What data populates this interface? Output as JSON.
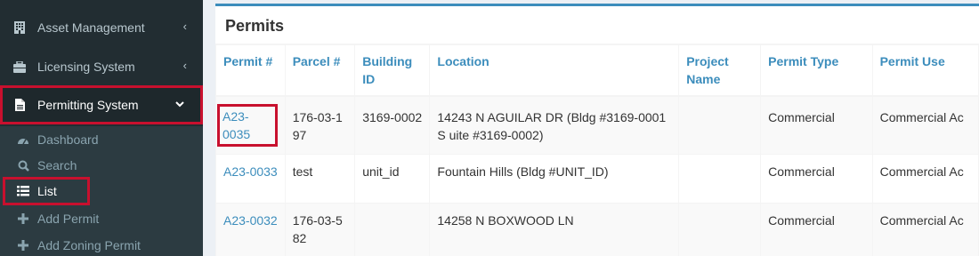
{
  "sidebar": {
    "items": [
      {
        "label": "Asset Management",
        "icon": "building-icon",
        "chevron": "‹"
      },
      {
        "label": "Licensing System",
        "icon": "briefcase-icon",
        "chevron": "‹"
      },
      {
        "label": "Permitting System",
        "icon": "file-icon",
        "chevron": "⌄"
      }
    ],
    "subitems": [
      {
        "label": "Dashboard",
        "icon": "dashboard-icon"
      },
      {
        "label": "Search",
        "icon": "search-icon"
      },
      {
        "label": "List",
        "icon": "list-icon"
      },
      {
        "label": "Add Permit",
        "icon": "plus-icon"
      },
      {
        "label": "Add Zoning Permit",
        "icon": "plus-icon"
      }
    ]
  },
  "box": {
    "title": "Permits"
  },
  "table": {
    "headers": {
      "permit": "Permit #",
      "parcel": "Parcel #",
      "building_line1": "Building",
      "building_line2": "ID",
      "location": "Location",
      "project_line1": "Project",
      "project_line2": "Name",
      "type": "Permit Type",
      "use": "Permit Use"
    },
    "rows": [
      {
        "permit": "A23-0035",
        "parcel": "176-03-1 97",
        "building": "3169-0002",
        "location": "14243 N AGUILAR DR (Bldg #3169-0001 S uite #3169-0002)",
        "project": "",
        "type": "Commercial",
        "use": "Commercial Ac"
      },
      {
        "permit": "A23-0033",
        "parcel": "test",
        "building": "unit_id",
        "location": "Fountain Hills (Bldg #UNIT_ID)",
        "project": "",
        "type": "Commercial",
        "use": "Commercial Ac"
      },
      {
        "permit": "A23-0032",
        "parcel": "176-03-5 82",
        "building": "",
        "location": "14258 N BOXWOOD LN",
        "project": "",
        "type": "Commercial",
        "use": "Commercial Ac"
      }
    ]
  },
  "colors": {
    "sidebar_bg": "#222d32",
    "accent": "#3c8dbc",
    "highlight": "#c8102e"
  }
}
